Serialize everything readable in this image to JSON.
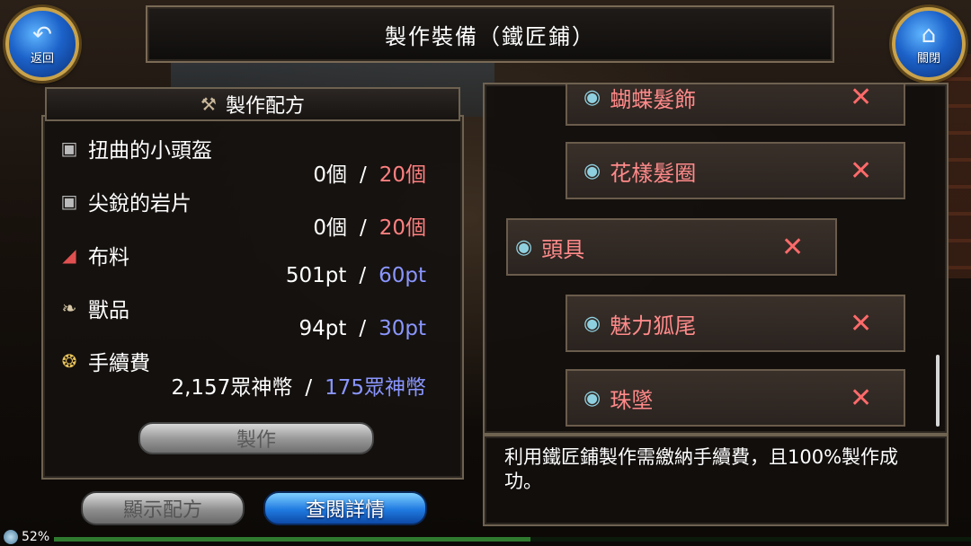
{
  "header": {
    "title": "製作裝備（鐵匠鋪）"
  },
  "nav": {
    "back_label": "返回",
    "back_icon": "back-arrow-icon",
    "close_label": "關閉",
    "close_icon": "home-icon"
  },
  "recipe": {
    "title": "製作配方",
    "materials": [
      {
        "name": "扭曲的小頭盔",
        "icon": "helmet-icon",
        "have": "0個",
        "need": "20個",
        "need_color": "red"
      },
      {
        "name": "尖銳的岩片",
        "icon": "rock-icon",
        "have": "0個",
        "need": "20個",
        "need_color": "red"
      },
      {
        "name": "布料",
        "icon": "cloth-icon",
        "have": "501pt",
        "need": "60pt",
        "need_color": "blue"
      },
      {
        "name": "獸品",
        "icon": "fang-icon",
        "have": "94pt",
        "need": "30pt",
        "need_color": "blue"
      },
      {
        "name": "手續費",
        "icon": "coins-icon",
        "have": "2,157眾神幣",
        "need": "175眾神幣",
        "need_color": "blue"
      }
    ],
    "separator": "/",
    "craft_label": "製作"
  },
  "buttons": {
    "show_recipe": "顯示配方",
    "view_details": "查閱詳情"
  },
  "list": {
    "items": [
      {
        "name": "蝴蝶髮飾",
        "icon": "hat-icon"
      },
      {
        "name": "花樣髮圈",
        "icon": "hat-icon"
      },
      {
        "name": "頭具",
        "icon": "hat-icon"
      },
      {
        "name": "魅力狐尾",
        "icon": "hat-icon"
      },
      {
        "name": "珠墜",
        "icon": "hat-icon"
      }
    ],
    "remove_symbol": "✕"
  },
  "description": "利用鐵匠鋪製作需繳納手續費，且100%製作成功。",
  "status": {
    "percent": "52%",
    "progress": 0.52
  },
  "colors": {
    "red": "#ff8080",
    "blue": "#8a96ff",
    "accent": "#1f7ae0"
  }
}
